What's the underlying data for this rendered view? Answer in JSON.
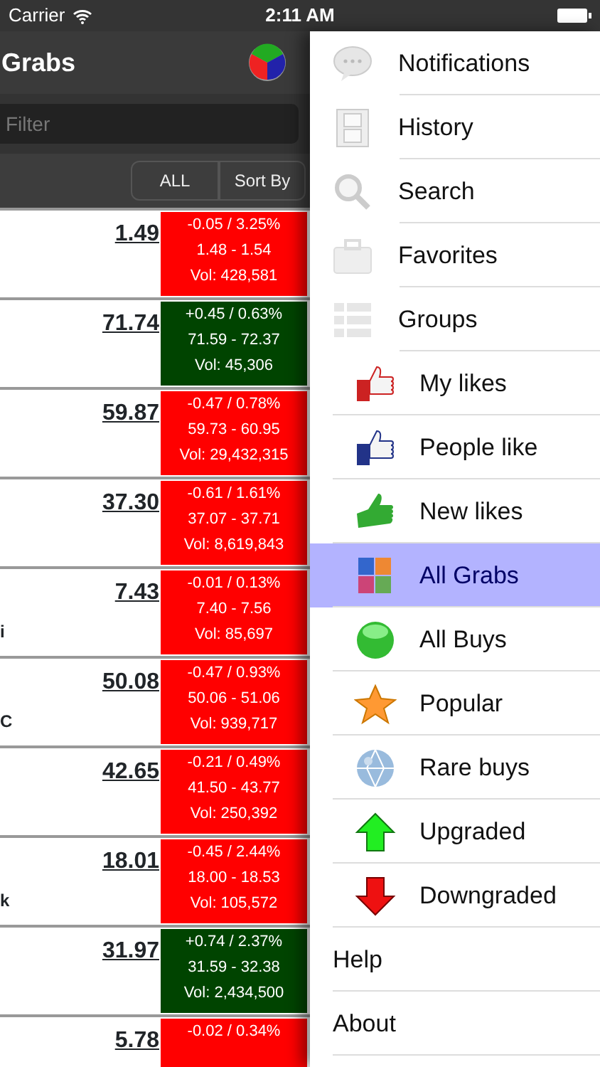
{
  "status_bar": {
    "carrier": "Carrier",
    "time": "2:11 AM"
  },
  "nav_bar": {
    "title": "Grabs"
  },
  "filter": {
    "placeholder": "Filter"
  },
  "toolbar": {
    "buttons": [
      "ALL",
      "Sort By"
    ]
  },
  "stocks": [
    {
      "price": "1.49",
      "color": "#ff0000",
      "change": "-0.05 / 3.25%",
      "range": "1.48 - 1.54",
      "volume": "Vol: 428,581"
    },
    {
      "price": "71.74",
      "color": "#004400",
      "change": "+0.45 / 0.63%",
      "range": "71.59 - 72.37",
      "volume": "Vol: 45,306"
    },
    {
      "price": "59.87",
      "color": "#ff0000",
      "change": "-0.47 / 0.78%",
      "range": "59.73 - 60.95",
      "volume": "Vol: 29,432,315"
    },
    {
      "price": "37.30",
      "color": "#ff0000",
      "change": "-0.61 / 1.61%",
      "range": "37.07 - 37.71",
      "volume": "Vol: 8,619,843"
    },
    {
      "name": "i",
      "price": "7.43",
      "color": "#ff0000",
      "change": "-0.01 / 0.13%",
      "range": "7.40 - 7.56",
      "volume": "Vol: 85,697"
    },
    {
      "name": "C",
      "price": "50.08",
      "color": "#ff0000",
      "change": "-0.47 / 0.93%",
      "range": "50.06 - 51.06",
      "volume": "Vol: 939,717"
    },
    {
      "price": "42.65",
      "color": "#ff0000",
      "change": "-0.21 / 0.49%",
      "range": "41.50 - 43.77",
      "volume": "Vol: 250,392"
    },
    {
      "name": "k",
      "price": "18.01",
      "color": "#ff0000",
      "change": "-0.45 / 2.44%",
      "range": "18.00 - 18.53",
      "volume": "Vol: 105,572"
    },
    {
      "price": "31.97",
      "color": "#004400",
      "change": "+0.74 / 2.37%",
      "range": "31.59 - 32.38",
      "volume": "Vol: 2,434,500"
    },
    {
      "price": "5.78",
      "color": "#ff0000",
      "change": "-0.02 / 0.34%"
    }
  ],
  "menu": [
    {
      "label": "Notifications",
      "kind": "main",
      "selected": false
    },
    {
      "label": "History",
      "kind": "main",
      "selected": false
    },
    {
      "label": "Search",
      "kind": "main",
      "selected": false
    },
    {
      "label": "Favorites",
      "kind": "main",
      "selected": false
    },
    {
      "label": "Groups",
      "kind": "main",
      "selected": false
    },
    {
      "label": "My likes",
      "kind": "sub",
      "selected": false
    },
    {
      "label": "People like",
      "kind": "sub",
      "selected": false
    },
    {
      "label": "New likes",
      "kind": "sub",
      "selected": false
    },
    {
      "label": "All Grabs",
      "kind": "sub",
      "selected": true
    },
    {
      "label": "All Buys",
      "kind": "sub",
      "selected": false
    },
    {
      "label": "Popular",
      "kind": "sub",
      "selected": false
    },
    {
      "label": "Rare buys",
      "kind": "sub",
      "selected": false
    },
    {
      "label": "Upgraded",
      "kind": "sub",
      "selected": false
    },
    {
      "label": "Downgraded",
      "kind": "sub",
      "selected": false
    },
    {
      "label": "Help",
      "kind": "plain",
      "selected": false
    },
    {
      "label": "About",
      "kind": "plain",
      "selected": false
    }
  ]
}
